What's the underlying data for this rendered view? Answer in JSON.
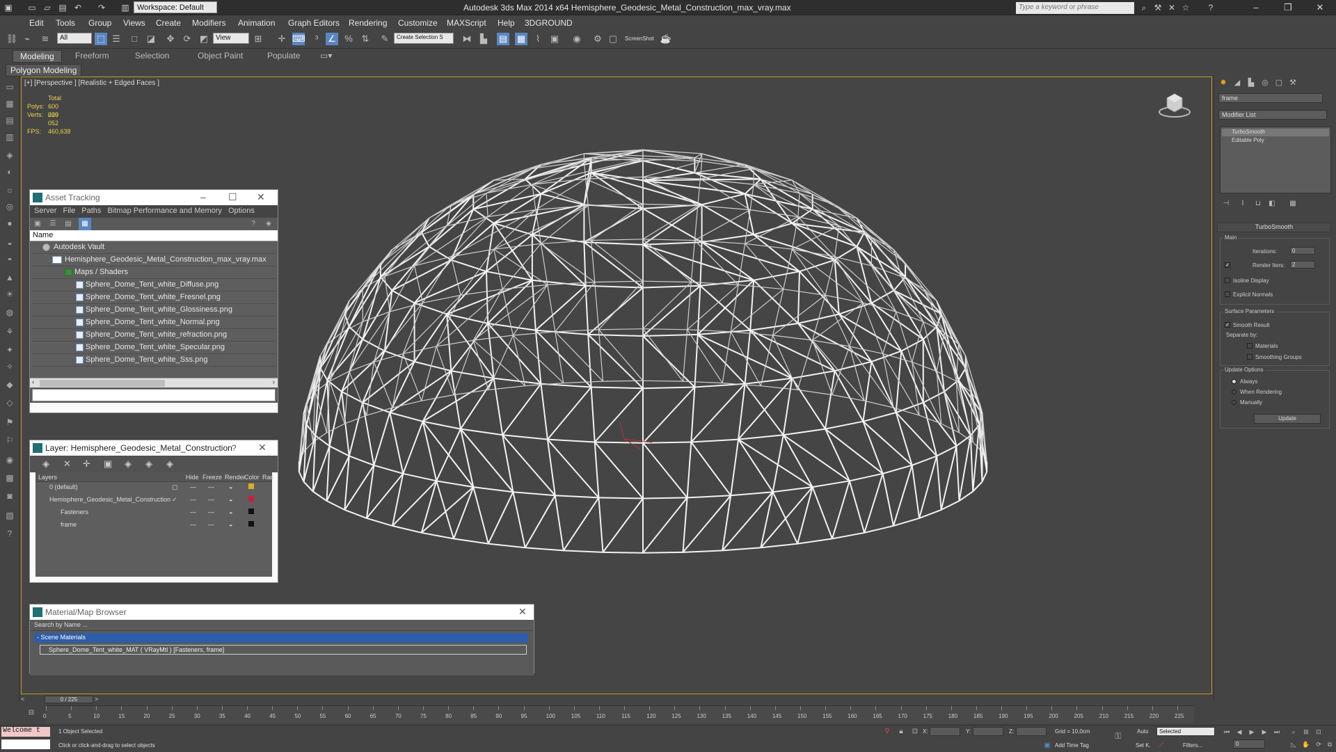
{
  "window": {
    "title": "Autodesk 3ds Max  2014 x64      Hemisphere_Geodesic_Metal_Construction_max_vray.max",
    "workspace": "Workspace: Default",
    "search_placeholder": "Type a keyword or phrase"
  },
  "menu": [
    "Edit",
    "Tools",
    "Group",
    "Views",
    "Create",
    "Modifiers",
    "Animation",
    "Graph Editors",
    "Rendering",
    "Customize",
    "MAXScript",
    "Help",
    "3DGROUND"
  ],
  "toolbar": {
    "selection_filter": "All",
    "ref_coord": "View",
    "named_selection": "Create Selection S",
    "screenshot_label": "ScreenShot"
  },
  "ribbon": {
    "tabs": [
      "Modeling",
      "Freeform",
      "Selection",
      "Object Paint",
      "Populate"
    ],
    "sub": "Polygon Modeling"
  },
  "viewport": {
    "label": "[+] [Perspective ] [Realistic + Edged Faces ]",
    "stats": {
      "total_label": "Total",
      "polys_label": "Polys:",
      "polys": "600 020",
      "verts_label": "Verts:",
      "verts": "299 052",
      "fps_label": "FPS:",
      "fps": "460,638"
    }
  },
  "asset_tracking": {
    "title": "Asset Tracking",
    "menu": [
      "Server",
      "File",
      "Paths",
      "Bitmap Performance and Memory",
      "Options"
    ],
    "column": "Name",
    "vault": "Autodesk Vault",
    "file": "Hemisphere_Geodesic_Metal_Construction_max_vray.max",
    "folder": "Maps / Shaders",
    "maps": [
      "Sphere_Dome_Tent_white_Diffuse.png",
      "Sphere_Dome_Tent_white_Fresnel.png",
      "Sphere_Dome_Tent_white_Glossiness.png",
      "Sphere_Dome_Tent_white_Normal.png",
      "Sphere_Dome_Tent_white_refraction.png",
      "Sphere_Dome_Tent_white_Specular.png",
      "Sphere_Dome_Tent_white_Sss.png"
    ]
  },
  "layer": {
    "title": "Layer: Hemisphere_Geodesic_Metal_Construction",
    "help": "?",
    "columns": [
      "Layers",
      "Hide",
      "Freeze",
      "Render",
      "Color",
      "Rad"
    ],
    "rows": [
      {
        "name": "0 (default)",
        "color": "#d8b020"
      },
      {
        "name": "Hemisphere_Geodesic_Metal_Construction",
        "color": "#c8203a"
      },
      {
        "name": "Fasteners",
        "color": "#111111"
      },
      {
        "name": "frame",
        "color": "#111111"
      }
    ]
  },
  "material_browser": {
    "title": "Material/Map Browser",
    "search": "Search by Name ...",
    "section": "- Scene Materials",
    "item": "Sphere_Dome_Tent_white_MAT  ( VRayMtl ) [Fasteners, frame]"
  },
  "command_panel": {
    "object_name": "frame",
    "modifier_list": "Modifier List",
    "stack": [
      "TurboSmooth",
      "Editable Poly"
    ],
    "rollout": "TurboSmooth",
    "main": {
      "label": "Main",
      "iterations_label": "Iterations:",
      "iterations": "0",
      "render_iters_label": "Render Iters:",
      "render_iters": "2",
      "isoline": "Isoline Display",
      "explicit": "Explicit Normals"
    },
    "surface": {
      "label": "Surface Parameters",
      "smooth_result": "Smooth Result",
      "separate_by": "Separate by:",
      "materials": "Materials",
      "smoothing_groups": "Smoothing Groups"
    },
    "update": {
      "label": "Update Options",
      "always": "Always",
      "when_rendering": "When Rendering",
      "manually": "Manually",
      "button": "Update"
    }
  },
  "timeline": {
    "slider": "0 / 225",
    "ticks": [
      "0",
      "5",
      "10",
      "15",
      "20",
      "25",
      "30",
      "35",
      "40",
      "45",
      "50",
      "55",
      "60",
      "65",
      "70",
      "75",
      "80",
      "85",
      "90",
      "95",
      "100",
      "105",
      "110",
      "115",
      "120",
      "125",
      "130",
      "135",
      "140",
      "145",
      "150",
      "155",
      "160",
      "165",
      "170",
      "175",
      "180",
      "185",
      "190",
      "195",
      "200",
      "205",
      "210",
      "215",
      "220",
      "225"
    ]
  },
  "status": {
    "listener": "Welcome t",
    "selected": "1 Object Selected",
    "prompt": "Click or click-and-drag to select objects",
    "x_label": "X:",
    "y_label": "Y:",
    "z_label": "Z:",
    "grid": "Grid = 10,0cm",
    "add_time_tag": "Add Time Tag",
    "auto": "Auto",
    "set_key": "Set K.",
    "key_mode": "Selected",
    "filters": "Filters...",
    "frame": "0"
  }
}
